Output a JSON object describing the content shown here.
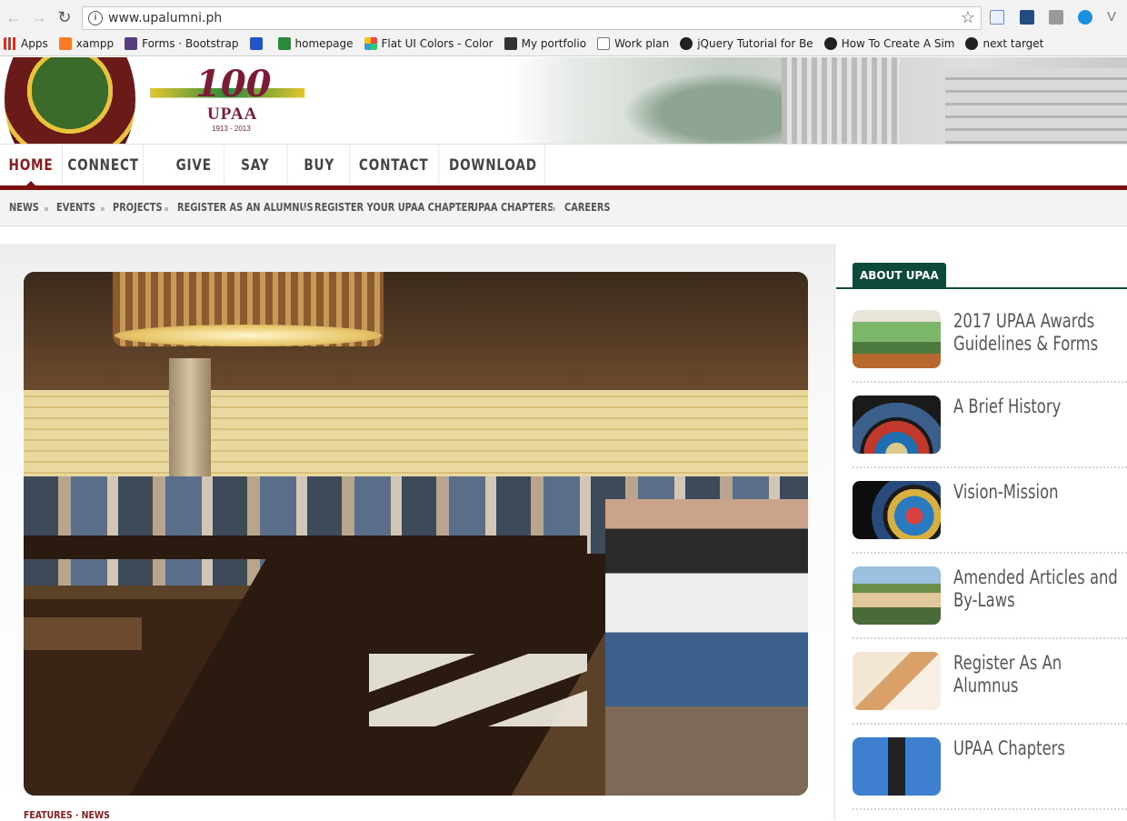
{
  "browser": {
    "url": "www.upalumni.ph",
    "bookmarks": [
      {
        "label": "Apps",
        "icon": "apps-grid-icon",
        "color": "#d93025"
      },
      {
        "label": "xampp",
        "icon": "xampp-icon",
        "color": "#fb7a24"
      },
      {
        "label": "Forms · Bootstrap",
        "icon": "bootstrap-icon",
        "color": "#563d7c"
      },
      {
        "label": "",
        "icon": "m-icon",
        "color": "#2255cc"
      },
      {
        "label": "homepage",
        "icon": "homepage-icon",
        "color": "#2a8a3a"
      },
      {
        "label": "Flat UI Colors - Color",
        "icon": "flat-ui-icon",
        "color": "#e74c3c"
      },
      {
        "label": "My portfolio",
        "icon": "portfolio-icon",
        "color": "#333333"
      },
      {
        "label": "Work plan",
        "icon": "document-icon",
        "color": "#ffffff"
      },
      {
        "label": "jQuery Tutorial for Be",
        "icon": "jquery-icon",
        "color": "#222222"
      },
      {
        "label": "How To Create A Sim",
        "icon": "tutorial-icon",
        "color": "#222222"
      },
      {
        "label": "next target",
        "icon": "target-icon",
        "color": "#222222"
      }
    ]
  },
  "header": {
    "seal_year": "1913",
    "centennial_number": "100",
    "centennial_name": "UPAA",
    "centennial_years": "1913 - 2013"
  },
  "main_nav": [
    "HOME",
    "CONNECT",
    "GIVE",
    "SAY",
    "BUY",
    "CONTACT",
    "DOWNLOAD"
  ],
  "sub_nav": [
    "NEWS",
    "EVENTS",
    "PROJECTS",
    "REGISTER AS AN ALUMNUS",
    "REGISTER YOUR UPAA CHAPTER",
    "UPAA CHAPTERS",
    "CAREERS"
  ],
  "main": {
    "category": "FEATURES · NEWS"
  },
  "sidebar": {
    "heading": "ABOUT UPAA",
    "items": [
      {
        "title": "2017 UPAA Awards Guidelines & Forms"
      },
      {
        "title": "A Brief History"
      },
      {
        "title": "Vision-Mission"
      },
      {
        "title": "Amended Articles and By-Laws"
      },
      {
        "title": "Register As An Alumnus"
      },
      {
        "title": "UPAA Chapters"
      }
    ]
  },
  "colors": {
    "maroon": "#7a1010",
    "green": "#0d4a3a"
  }
}
